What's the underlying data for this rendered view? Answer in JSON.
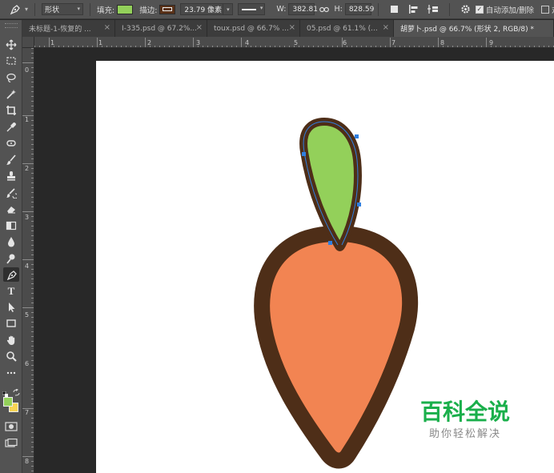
{
  "options_bar": {
    "shape_mode": "形状",
    "fill_label": "填充:",
    "fill_color": "#93d05a",
    "stroke_label": "描边:",
    "stroke_color": "#5a3219",
    "stroke_width": "23.79 像素",
    "width_label": "W:",
    "width_value": "382.81",
    "link_icon": "link-icon",
    "height_label": "H:",
    "height_value": "828.59",
    "auto_add_delete_label": "自动添加/删除",
    "align_edges_label": "对齐"
  },
  "tabs": [
    {
      "label": "未标题-1-恢复的 ...",
      "active": false
    },
    {
      "label": "I-335.psd @ 67.2%...",
      "active": false
    },
    {
      "label": "toux.psd @ 66.7% ...",
      "active": false
    },
    {
      "label": "05.psd @ 61.1% (...",
      "active": false
    },
    {
      "label": "胡萝卜.psd @ 66.7% (形状 2, RGB/8) *",
      "active": true
    }
  ],
  "ruler": {
    "horizontal_ticks": [
      "1",
      "1",
      "2",
      "3",
      "4",
      "5",
      "6",
      "7",
      "8",
      "9"
    ],
    "vertical_ticks": [
      "0",
      "1",
      "2",
      "3",
      "4",
      "5",
      "6",
      "7",
      "8"
    ]
  },
  "toolbar": {
    "tools": [
      "move-icon",
      "marquee-icon",
      "lasso-icon",
      "magic-wand-icon",
      "crop-icon",
      "eyedropper-icon",
      "healing-brush-icon",
      "brush-icon",
      "clone-stamp-icon",
      "history-brush-icon",
      "eraser-icon",
      "gradient-icon",
      "blur-icon",
      "dodge-icon",
      "pen-icon",
      "type-icon",
      "path-selection-icon",
      "rectangle-icon",
      "hand-icon",
      "zoom-icon",
      "more-icon"
    ],
    "active_tool": "pen-icon",
    "type_tool_label": "T",
    "foreground_color": "#93d05a",
    "background_color": "#f6d454"
  },
  "artwork": {
    "carrot_body_color": "#f28452",
    "carrot_outline_color": "#4e2e18",
    "leaf_color": "#93d05a"
  },
  "watermark": {
    "title": "百科全说",
    "subtitle": "助你轻松解决",
    "title_color": "#1aaf4b"
  }
}
